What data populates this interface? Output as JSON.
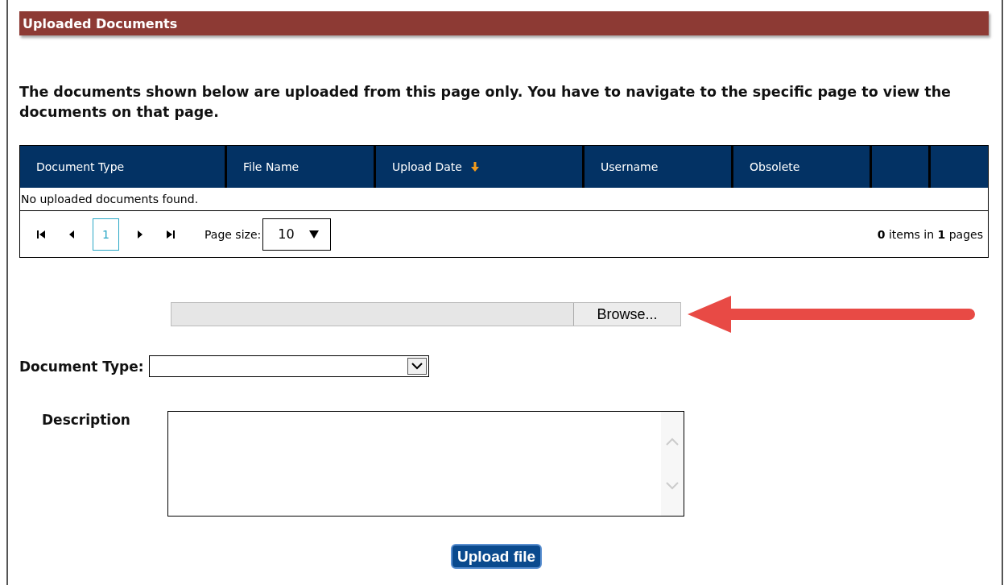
{
  "section_title": "Uploaded Documents",
  "intro": "The documents shown below are uploaded from this page only. You have to navigate to the specific page to view the documents on that page.",
  "table": {
    "columns": [
      {
        "label": "Document Type",
        "sorted": false
      },
      {
        "label": "File Name",
        "sorted": false
      },
      {
        "label": "Upload Date",
        "sorted": true
      },
      {
        "label": "Username",
        "sorted": false
      },
      {
        "label": "Obsolete",
        "sorted": false
      },
      {
        "sorted": false
      },
      {
        "sorted": false
      }
    ],
    "empty_message": "No uploaded documents found.",
    "pager": {
      "pages": [
        {
          "label": "1",
          "selected": true
        }
      ],
      "page_size_label": "Page size:",
      "page_size": "10",
      "summary": "**0** items in **1** pages"
    }
  },
  "upload": {
    "browse_button": "Browse...",
    "document_type_label": "Document Type:",
    "description_label": "Description",
    "upload_button": "Upload file"
  }
}
